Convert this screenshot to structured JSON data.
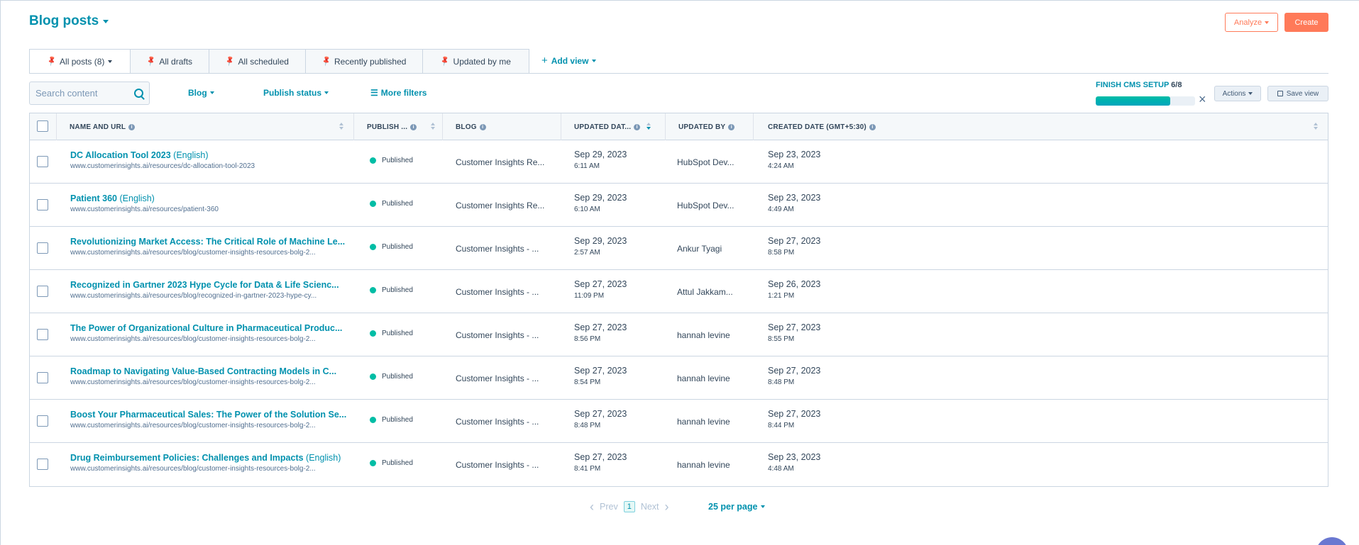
{
  "header": {
    "title": "Blog posts",
    "analyze_label": "Analyze",
    "create_label": "Create"
  },
  "tabs": [
    {
      "label": "All posts (8)",
      "active": true
    },
    {
      "label": "All drafts"
    },
    {
      "label": "All scheduled"
    },
    {
      "label": "Recently published"
    },
    {
      "label": "Updated by me"
    }
  ],
  "add_view_label": "Add view",
  "search": {
    "placeholder": "Search content"
  },
  "filters": {
    "blog": "Blog",
    "publish_status": "Publish status",
    "more": "More filters"
  },
  "cms_setup": {
    "label": "FINISH CMS SETUP",
    "progress": "6/8",
    "fraction": 0.75
  },
  "toolbar": {
    "actions_label": "Actions",
    "save_view_label": "Save view"
  },
  "colors": {
    "accent": "#0091ae",
    "brand": "#ff7a59",
    "published": "#00bda5"
  },
  "table": {
    "columns": {
      "name": "NAME AND URL",
      "publish": "PUBLISH ...",
      "blog": "BLOG",
      "updated_date": "UPDATED DAT...",
      "updated_by": "UPDATED BY",
      "created_date": "CREATED DATE (GMT+5:30)"
    },
    "rows": [
      {
        "title": "DC Allocation Tool 2023",
        "lang": "(English)",
        "url": "www.customerinsights.ai/resources/dc-allocation-tool-2023",
        "status": "Published",
        "blog": "Customer Insights Re...",
        "updated_date": "Sep 29, 2023",
        "updated_time": "6:11 AM",
        "updated_by": "HubSpot Dev...",
        "created_date": "Sep 23, 2023",
        "created_time": "4:24 AM"
      },
      {
        "title": "Patient 360",
        "lang": "(English)",
        "url": "www.customerinsights.ai/resources/patient-360",
        "status": "Published",
        "blog": "Customer Insights Re...",
        "updated_date": "Sep 29, 2023",
        "updated_time": "6:10 AM",
        "updated_by": "HubSpot Dev...",
        "created_date": "Sep 23, 2023",
        "created_time": "4:49 AM"
      },
      {
        "title": "Revolutionizing Market Access: The Critical Role of Machine Le...",
        "lang": "",
        "url": "www.customerinsights.ai/resources/blog/customer-insights-resources-bolg-2...",
        "status": "Published",
        "blog": "Customer Insights - ...",
        "updated_date": "Sep 29, 2023",
        "updated_time": "2:57 AM",
        "updated_by": "Ankur Tyagi",
        "created_date": "Sep 27, 2023",
        "created_time": "8:58 PM"
      },
      {
        "title": "Recognized in Gartner 2023 Hype Cycle for Data & Life Scienc...",
        "lang": "",
        "url": "www.customerinsights.ai/resources/blog/recognized-in-gartner-2023-hype-cy...",
        "status": "Published",
        "blog": "Customer Insights - ...",
        "updated_date": "Sep 27, 2023",
        "updated_time": "11:09 PM",
        "updated_by": "Attul Jakkam...",
        "created_date": "Sep 26, 2023",
        "created_time": "1:21 PM"
      },
      {
        "title": "The Power of Organizational Culture in Pharmaceutical Produc...",
        "lang": "",
        "url": "www.customerinsights.ai/resources/blog/customer-insights-resources-bolg-2...",
        "status": "Published",
        "blog": "Customer Insights - ...",
        "updated_date": "Sep 27, 2023",
        "updated_time": "8:56 PM",
        "updated_by": "hannah levine",
        "created_date": "Sep 27, 2023",
        "created_time": "8:55 PM"
      },
      {
        "title": "Roadmap to Navigating Value-Based Contracting Models in C...",
        "lang": "",
        "url": "www.customerinsights.ai/resources/blog/customer-insights-resources-bolg-2...",
        "status": "Published",
        "blog": "Customer Insights - ...",
        "updated_date": "Sep 27, 2023",
        "updated_time": "8:54 PM",
        "updated_by": "hannah levine",
        "created_date": "Sep 27, 2023",
        "created_time": "8:48 PM"
      },
      {
        "title": "Boost Your Pharmaceutical Sales: The Power of the Solution Se...",
        "lang": "",
        "url": "www.customerinsights.ai/resources/blog/customer-insights-resources-bolg-2...",
        "status": "Published",
        "blog": "Customer Insights - ...",
        "updated_date": "Sep 27, 2023",
        "updated_time": "8:48 PM",
        "updated_by": "hannah levine",
        "created_date": "Sep 27, 2023",
        "created_time": "8:44 PM"
      },
      {
        "title": "Drug Reimbursement Policies: Challenges and Impacts",
        "lang": "(English)",
        "url": "www.customerinsights.ai/resources/blog/customer-insights-resources-bolg-2...",
        "status": "Published",
        "blog": "Customer Insights - ...",
        "updated_date": "Sep 27, 2023",
        "updated_time": "8:41 PM",
        "updated_by": "hannah levine",
        "created_date": "Sep 23, 2023",
        "created_time": "4:48 AM"
      }
    ]
  },
  "pagination": {
    "prev": "Prev",
    "page": "1",
    "next": "Next",
    "per_page": "25 per page"
  }
}
